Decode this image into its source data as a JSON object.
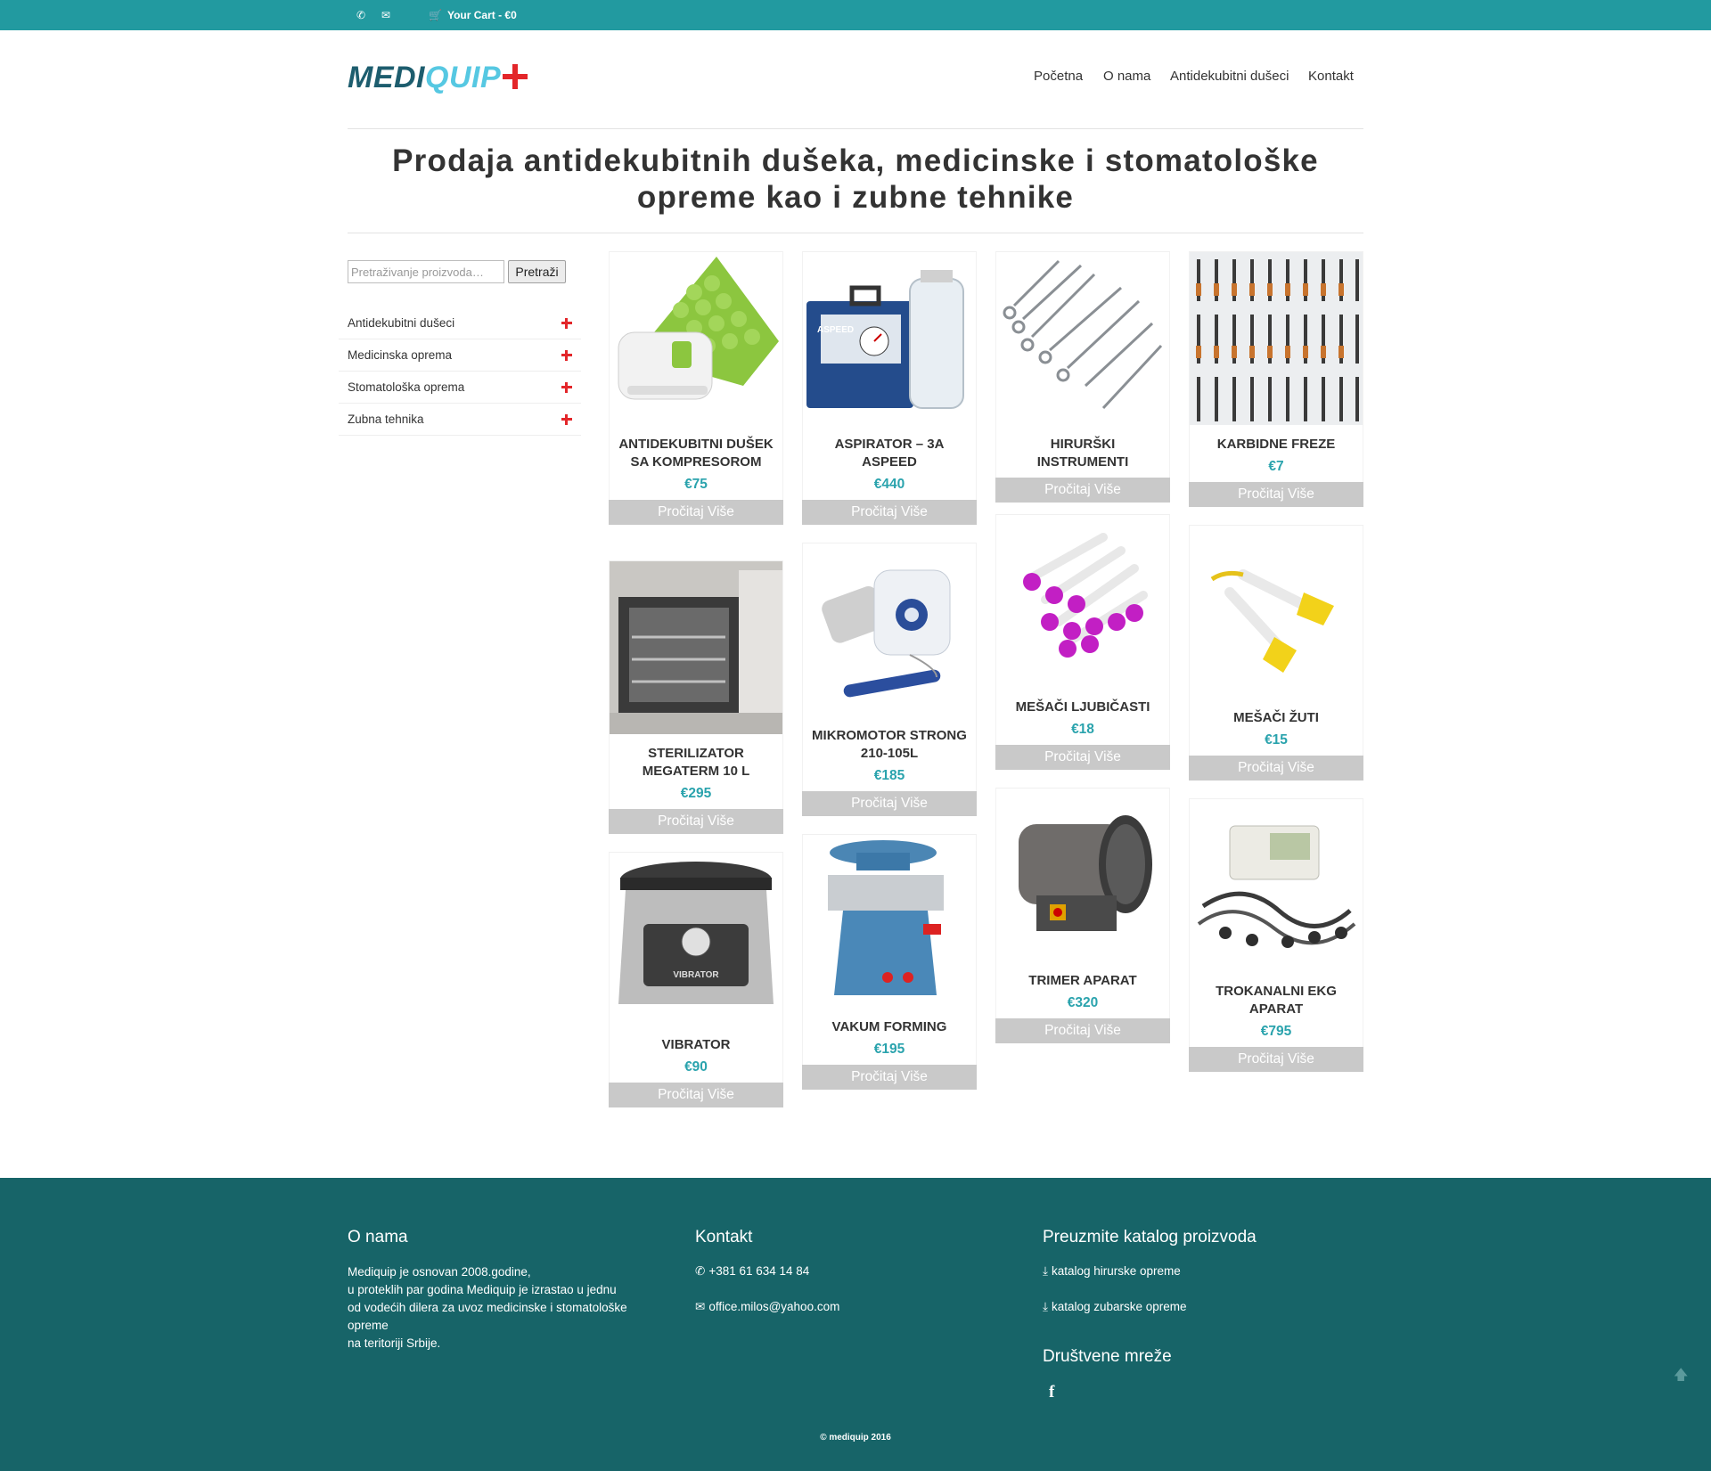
{
  "topbar": {
    "phone_icon": "phone-icon",
    "mail_icon": "envelope-icon",
    "cart_icon": "cart-icon",
    "cart_label": "Your Cart - €0"
  },
  "logo": {
    "part1": "MEDI",
    "part2": "QUIP"
  },
  "nav": {
    "items": [
      {
        "label": "Početna"
      },
      {
        "label": "O nama"
      },
      {
        "label": "Antidekubitni dušeci"
      },
      {
        "label": "Kontakt"
      }
    ]
  },
  "hero": {
    "title_line1": "Prodaja antidekubitnih dušeka, medicinske i stomatološke",
    "title_line2": "opreme kao i zubne tehnike"
  },
  "search": {
    "placeholder": "Pretraživanje proizvoda…",
    "value": "",
    "button_label": "Pretraži"
  },
  "categories": [
    {
      "label": "Antidekubitni dušeci"
    },
    {
      "label": "Medicinska oprema"
    },
    {
      "label": "Stomatološka oprema"
    },
    {
      "label": "Zubna tehnika"
    }
  ],
  "products": [
    {
      "title": "ANTIDEKUBITNI DUŠEK SA KOMPRESOROM",
      "price": "€75",
      "more": "Pročitaj Više"
    },
    {
      "title": "ASPIRATOR – 3A ASPEED",
      "price": "€440",
      "more": "Pročitaj Više"
    },
    {
      "title": "HIRURŠKI INSTRUMENTI",
      "price": "",
      "more": "Pročitaj Više"
    },
    {
      "title": "KARBIDNE FREZE",
      "price": "€7",
      "more": "Pročitaj Više"
    },
    {
      "title": "STERILIZATOR MEGATERM 10 L",
      "price": "€295",
      "more": "Pročitaj Više"
    },
    {
      "title": "MIKROMOTOR STRONG 210-105L",
      "price": "€185",
      "more": "Pročitaj Više"
    },
    {
      "title": "MEŠAČI LJUBIČASTI",
      "price": "€18",
      "more": "Pročitaj Više"
    },
    {
      "title": "MEŠAČI ŽUTI",
      "price": "€15",
      "more": "Pročitaj Više"
    },
    {
      "title": "VIBRATOR",
      "price": "€90",
      "more": "Pročitaj Više"
    },
    {
      "title": "VAKUM FORMING",
      "price": "€195",
      "more": "Pročitaj Više"
    },
    {
      "title": "TRIMER APARAT",
      "price": "€320",
      "more": "Pročitaj Više"
    },
    {
      "title": "TROKANALNI EKG APARAT",
      "price": "€795",
      "more": "Pročitaj Više"
    }
  ],
  "footer": {
    "about_heading": "O nama",
    "about_text": "Mediquip je osnovan 2008.godine,\nu proteklih par godina Mediquip je izrastao u jednu\nod vodećih dilera za uvoz medicinske i stomatološke\nopreme\nna teritoriji Srbije.",
    "contact_heading": "Kontakt",
    "phone": "+381 61 634 14 84",
    "email": "office.milos@yahoo.com",
    "catalog_heading": "Preuzmite katalog proizvoda",
    "catalog1": "katalog hirurske opreme",
    "catalog2": "katalog zubarske opreme",
    "social_heading": "Društvene mreže",
    "facebook_icon": "facebook-icon",
    "copyright": "© mediquip 2016",
    "scroll_top_icon": "arrow-up-icon"
  },
  "colors": {
    "topbar": "#229aa0",
    "footer": "#176468",
    "price": "#2aa3ad",
    "accent_red": "#e3262a",
    "logo_dark": "#1d5d6e",
    "logo_light": "#56c8e2"
  }
}
